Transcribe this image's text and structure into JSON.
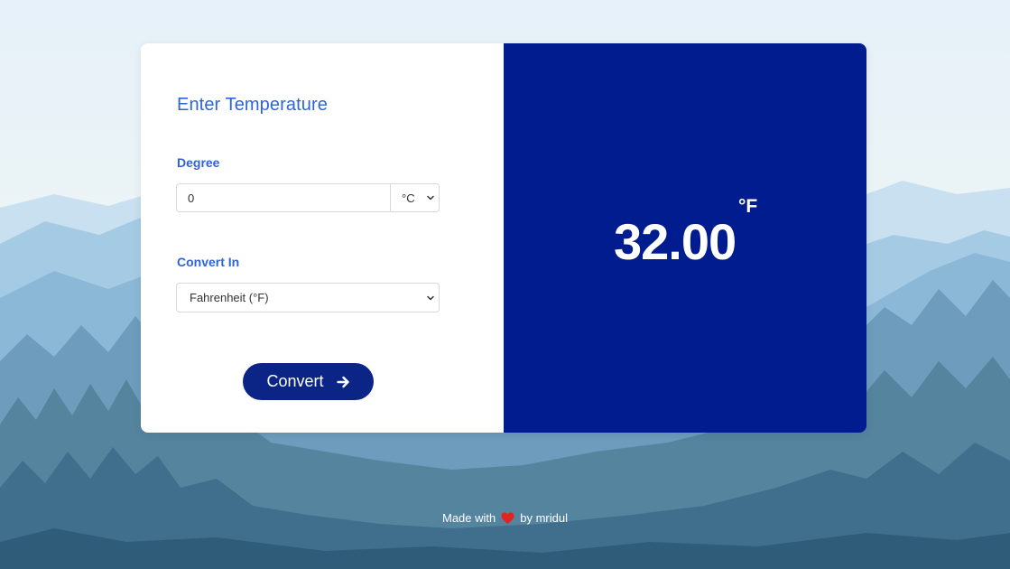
{
  "form": {
    "heading": "Enter Temperature",
    "degree_label": "Degree",
    "degree_value": "0",
    "degree_unit": "°C",
    "convert_label": "Convert In",
    "convert_selected": "Fahrenheit (°F)",
    "button_label": "Convert"
  },
  "result": {
    "value": "32.00",
    "unit": "°F"
  },
  "footer": {
    "made_with": "Made with",
    "by": "by mridul"
  },
  "colors": {
    "accent": "#2e65d6",
    "panel": "#001c8f",
    "button": "#0a2585",
    "heart": "#e0241f"
  },
  "icons": {
    "button_icon": "arrow-right-icon",
    "select_icon": "chevron-down-icon",
    "footer_icon": "heart-icon"
  }
}
